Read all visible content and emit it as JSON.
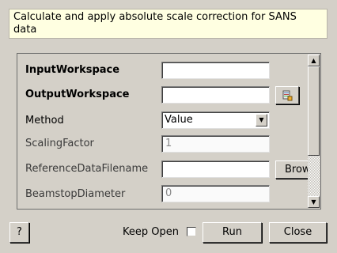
{
  "description": "Calculate and apply absolute scale correction for SANS data",
  "properties": [
    {
      "label": "InputWorkspace",
      "value": ""
    },
    {
      "label": "OutputWorkspace",
      "value": ""
    },
    {
      "label": "Method",
      "value": "Value"
    },
    {
      "label": "ScalingFactor",
      "value": "1"
    },
    {
      "label": "ReferenceDataFilename",
      "value": ""
    },
    {
      "label": "BeamstopDiameter",
      "value": "0"
    }
  ],
  "browse_label": "Browse",
  "workspace_icon": "workspace-picker-icon",
  "footer": {
    "help_label": "?",
    "keep_open_label": "Keep Open",
    "keep_open_checked": false,
    "run_label": "Run",
    "close_label": "Close"
  }
}
